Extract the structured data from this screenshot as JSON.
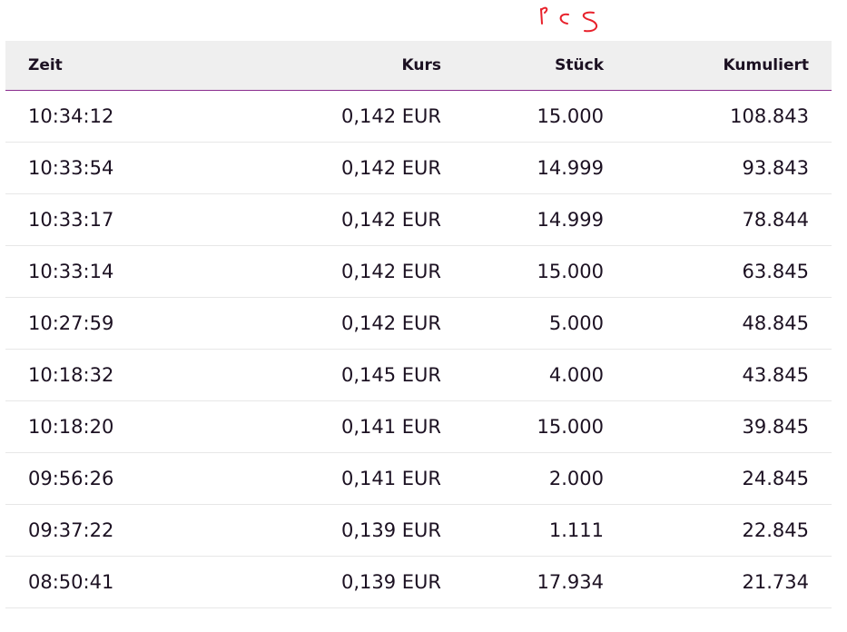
{
  "table": {
    "columns": [
      "Zeit",
      "Kurs",
      "Stück",
      "Kumuliert"
    ],
    "rows": [
      {
        "zeit": "10:34:12",
        "kurs": "0,142 EUR",
        "stueck": "15.000",
        "kumuliert": "108.843"
      },
      {
        "zeit": "10:33:54",
        "kurs": "0,142 EUR",
        "stueck": "14.999",
        "kumuliert": "93.843"
      },
      {
        "zeit": "10:33:17",
        "kurs": "0,142 EUR",
        "stueck": "14.999",
        "kumuliert": "78.844"
      },
      {
        "zeit": "10:33:14",
        "kurs": "0,142 EUR",
        "stueck": "15.000",
        "kumuliert": "63.845"
      },
      {
        "zeit": "10:27:59",
        "kurs": "0,142 EUR",
        "stueck": "5.000",
        "kumuliert": "48.845"
      },
      {
        "zeit": "10:18:32",
        "kurs": "0,145 EUR",
        "stueck": "4.000",
        "kumuliert": "43.845"
      },
      {
        "zeit": "10:18:20",
        "kurs": "0,141 EUR",
        "stueck": "15.000",
        "kumuliert": "39.845"
      },
      {
        "zeit": "09:56:26",
        "kurs": "0,141 EUR",
        "stueck": "2.000",
        "kumuliert": "24.845"
      },
      {
        "zeit": "09:37:22",
        "kurs": "0,139 EUR",
        "stueck": "1.111",
        "kumuliert": "22.845"
      },
      {
        "zeit": "08:50:41",
        "kurs": "0,139 EUR",
        "stueck": "17.934",
        "kumuliert": "21.734"
      }
    ]
  },
  "annotation": {
    "text": "Pcs",
    "color": "#e8212b"
  },
  "colors": {
    "header_bg": "#efefef",
    "header_border": "#8a2d8e",
    "row_border": "#e7e7e7",
    "text": "#1c1122"
  }
}
